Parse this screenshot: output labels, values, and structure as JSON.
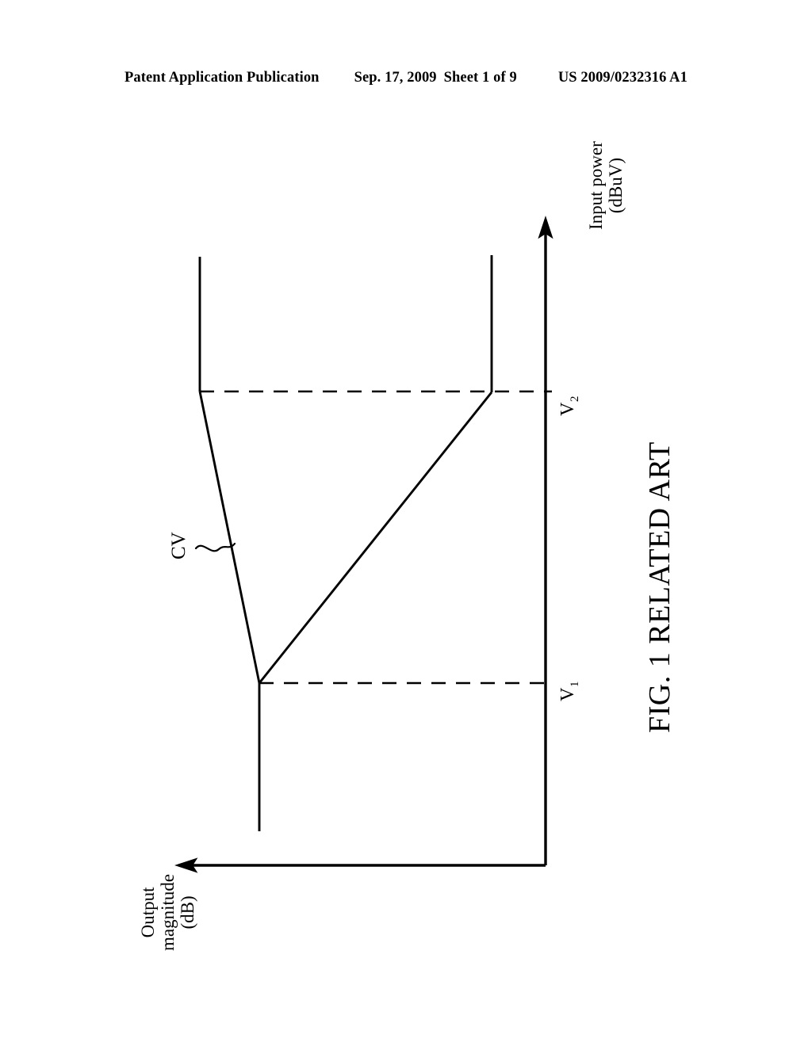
{
  "header": {
    "publication": "Patent Application Publication",
    "date": "Sep. 17, 2009",
    "sheet": "Sheet 1 of 9",
    "patent_number": "US 2009/0232316 A1"
  },
  "figure": {
    "caption": "FIG. 1 RELATED ART",
    "curve_label": "CV",
    "x_axis_label_line1": "Input power",
    "x_axis_label_line2": "(dBuV)",
    "y_axis_label_line1": "Output",
    "y_axis_label_line2": "magnitude",
    "y_axis_label_line3": "(dB)",
    "tick_v1_base": "V",
    "tick_v1_sub": "1",
    "tick_v2_base": "V",
    "tick_v2_sub": "2"
  },
  "chart_data": {
    "type": "line",
    "title": "FIG. 1 RELATED ART",
    "xlabel": "Input power (dBuV)",
    "ylabel": "Output magnitude (dB)",
    "orientation": "rotated-90-ccw",
    "grid": false,
    "legend": false,
    "series": [
      {
        "name": "CV",
        "annotation": "CV",
        "points": [
          {
            "x_label": "",
            "x": 0.0,
            "y": 1.0,
            "note": "flat maximum output at low input power"
          },
          {
            "x_label": "V1",
            "x": 0.36,
            "y": 1.0,
            "note": "knee point, start of gain reduction"
          },
          {
            "x_label": "V2",
            "x": 0.82,
            "y": 0.27,
            "note": "second knee point, end of gain reduction"
          },
          {
            "x_label": "",
            "x": 1.0,
            "y": 0.27,
            "note": "flat minimum output at high input power"
          }
        ]
      }
    ],
    "reference_lines": [
      {
        "label": "V1",
        "type": "dashed",
        "axis": "x",
        "value": 0.36
      },
      {
        "label": "V2",
        "type": "dashed",
        "axis": "x",
        "value": 0.82
      }
    ],
    "tick_labels": [
      "V1",
      "V2"
    ],
    "annotations": [
      {
        "text": "CV",
        "target": "curve",
        "leader": "squiggle"
      }
    ]
  },
  "colors": {
    "ink": "#000000",
    "paper": "#ffffff"
  }
}
